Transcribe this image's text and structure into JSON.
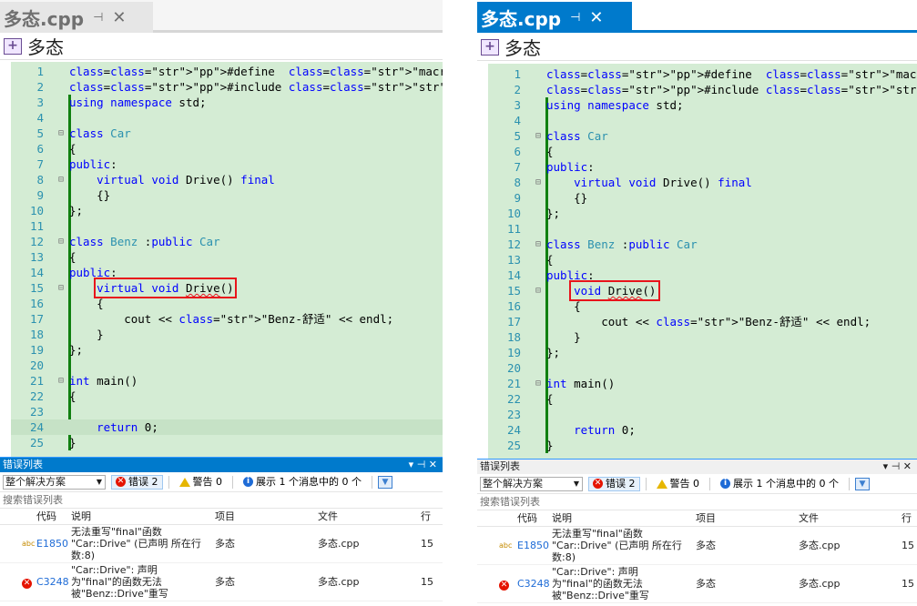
{
  "panes": [
    {
      "tab": {
        "filename": "多态.cpp",
        "pin_icon": "pin-icon",
        "close_icon": "close-icon"
      },
      "navbar": {
        "project": "多态",
        "icon": "project-icon"
      },
      "code": [
        {
          "n": "1",
          "t": "#define  _CRT_SECURE_NO_WARNINGS"
        },
        {
          "n": "2",
          "t": "#include <iostream>"
        },
        {
          "n": "3",
          "t": "using namespace std;"
        },
        {
          "n": "4",
          "t": ""
        },
        {
          "n": "5",
          "t": "class Car"
        },
        {
          "n": "6",
          "t": "{"
        },
        {
          "n": "7",
          "t": "public:"
        },
        {
          "n": "8",
          "t": "    virtual void Drive() final"
        },
        {
          "n": "9",
          "t": "    {}"
        },
        {
          "n": "10",
          "t": "};"
        },
        {
          "n": "11",
          "t": ""
        },
        {
          "n": "12",
          "t": "class Benz :public Car"
        },
        {
          "n": "13",
          "t": "{"
        },
        {
          "n": "14",
          "t": "public:"
        },
        {
          "n": "15",
          "t": "    virtual void Drive()"
        },
        {
          "n": "16",
          "t": "    {"
        },
        {
          "n": "17",
          "t": "        cout << \"Benz-舒适\" << endl;"
        },
        {
          "n": "18",
          "t": "    }"
        },
        {
          "n": "19",
          "t": "};"
        },
        {
          "n": "20",
          "t": ""
        },
        {
          "n": "21",
          "t": "int main()"
        },
        {
          "n": "22",
          "t": "{"
        },
        {
          "n": "23",
          "t": ""
        },
        {
          "n": "24",
          "t": "    return 0;"
        },
        {
          "n": "25",
          "t": "}"
        }
      ],
      "error_list": {
        "title": "错误列表",
        "scope": "整个解决方案",
        "errors_label": "错误 2",
        "warnings_label": "警告 0",
        "messages_label": "展示 1 个消息中的 0 个",
        "search_placeholder": "搜索错误列表",
        "columns": {
          "code": "代码",
          "desc": "说明",
          "project": "项目",
          "file": "文件",
          "line": "行"
        },
        "rows": [
          {
            "code": "E1850",
            "desc": "无法重写\"final\"函数\n\"Car::Drive\" (已声明 所在行\n数:8)",
            "project": "多态",
            "file": "多态.cpp",
            "line": "15"
          },
          {
            "code": "C3248",
            "desc": "\"Car::Drive\": 声明\n为\"final\"的函数无法\n被\"Benz::Drive\"重写",
            "project": "多态",
            "file": "多态.cpp",
            "line": "15"
          }
        ]
      }
    },
    {
      "tab": {
        "filename": "多态.cpp",
        "pin_icon": "pin-icon",
        "close_icon": "close-icon"
      },
      "navbar": {
        "project": "多态",
        "icon": "project-icon"
      },
      "code": [
        {
          "n": "1",
          "t": "#define  _CRT_SECURE_NO_WARNINGS"
        },
        {
          "n": "2",
          "t": "#include <iostream>"
        },
        {
          "n": "3",
          "t": "using namespace std;"
        },
        {
          "n": "4",
          "t": ""
        },
        {
          "n": "5",
          "t": "class Car"
        },
        {
          "n": "6",
          "t": "{"
        },
        {
          "n": "7",
          "t": "public:"
        },
        {
          "n": "8",
          "t": "    virtual void Drive() final"
        },
        {
          "n": "9",
          "t": "    {}"
        },
        {
          "n": "10",
          "t": "};"
        },
        {
          "n": "11",
          "t": ""
        },
        {
          "n": "12",
          "t": "class Benz :public Car"
        },
        {
          "n": "13",
          "t": "{"
        },
        {
          "n": "14",
          "t": "public:"
        },
        {
          "n": "15",
          "t": "    void Drive()"
        },
        {
          "n": "16",
          "t": "    {"
        },
        {
          "n": "17",
          "t": "        cout << \"Benz-舒适\" << endl;"
        },
        {
          "n": "18",
          "t": "    }"
        },
        {
          "n": "19",
          "t": "};"
        },
        {
          "n": "20",
          "t": ""
        },
        {
          "n": "21",
          "t": "int main()"
        },
        {
          "n": "22",
          "t": "{"
        },
        {
          "n": "23",
          "t": ""
        },
        {
          "n": "24",
          "t": "    return 0;"
        },
        {
          "n": "25",
          "t": "}"
        }
      ],
      "error_list": {
        "title": "错误列表",
        "scope": "整个解决方案",
        "errors_label": "错误 2",
        "warnings_label": "警告 0",
        "messages_label": "展示 1 个消息中的 0 个",
        "search_placeholder": "搜索错误列表",
        "columns": {
          "code": "代码",
          "desc": "说明",
          "project": "项目",
          "file": "文件",
          "line": "行"
        },
        "rows": [
          {
            "code": "E1850",
            "desc": "无法重写\"final\"函数\n\"Car::Drive\" (已声明 所在行\n数:8)",
            "project": "多态",
            "file": "多态.cpp",
            "line": "15"
          },
          {
            "code": "C3248",
            "desc": "\"Car::Drive\": 声明\n为\"final\"的函数无法\n被\"Benz::Drive\"重写",
            "project": "多态",
            "file": "多态.cpp",
            "line": "15"
          }
        ]
      }
    }
  ],
  "colors": {
    "accent": "#007acc",
    "editor_bg": "#d4ecd4",
    "highlight_box": "#e8141b",
    "change_bar": "#108010"
  }
}
